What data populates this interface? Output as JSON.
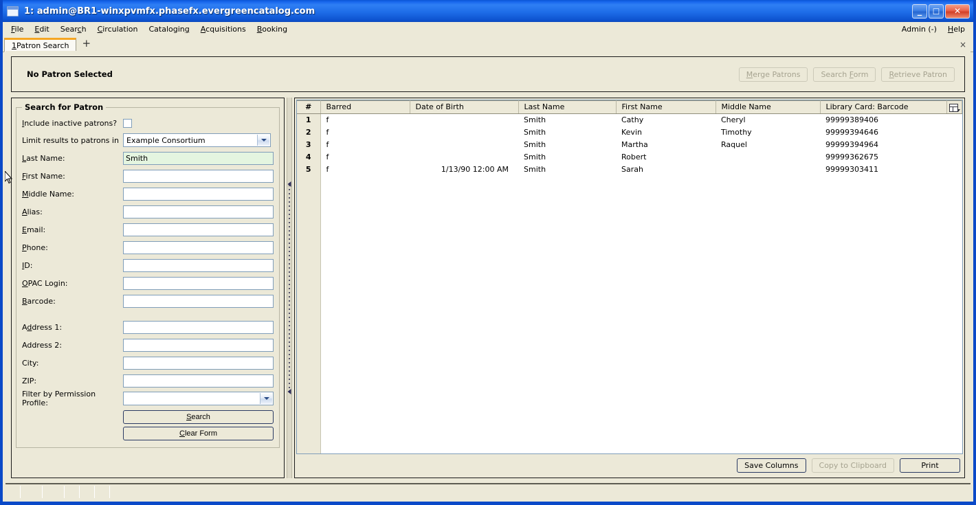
{
  "window": {
    "title": "1: admin@BR1-winxpvmfx.phasefx.evergreencatalog.com",
    "minimize_label": "_",
    "maximize_label": "□",
    "close_label": "✕",
    "icon": "window-icon"
  },
  "menubar": {
    "items": [
      {
        "acc": "F",
        "rest": "ile"
      },
      {
        "acc": "E",
        "rest": "dit"
      },
      {
        "pre": "Sear",
        "acc": "c",
        "rest": "h"
      },
      {
        "acc": "C",
        "rest": "irculation"
      },
      {
        "pre": "Catalogin",
        "acc": "g",
        "rest": ""
      },
      {
        "acc": "A",
        "rest": "cquisitions"
      },
      {
        "acc": "B",
        "rest": "ooking"
      }
    ],
    "right_items": [
      {
        "pre": "Admin (-)",
        "acc": "",
        "rest": ""
      },
      {
        "acc": "H",
        "rest": "elp"
      }
    ]
  },
  "tabs": {
    "active": {
      "num": "1",
      "label": " Patron Search"
    },
    "add_label": "+",
    "close_label": "×"
  },
  "patron_summary": {
    "title": "No Patron Selected",
    "buttons": [
      {
        "name": "merge-patrons-button",
        "acc": "M",
        "rest": "erge Patrons",
        "disabled": true
      },
      {
        "name": "search-form-button",
        "pre": "Search ",
        "acc": "F",
        "rest": "orm",
        "disabled": true
      },
      {
        "name": "retrieve-patron-button",
        "acc": "R",
        "rest": "etrieve Patron",
        "disabled": true
      }
    ]
  },
  "search_form": {
    "legend": "Search for Patron",
    "include_inactive": {
      "label_pre": "",
      "label_acc": "I",
      "label_rest": "nclude inactive patrons?",
      "checked": false
    },
    "limit_results": {
      "label": "Limit results to patrons in",
      "value": "Example Consortium"
    },
    "fields": [
      {
        "name": "last-name-field",
        "label_acc": "L",
        "label_rest": "ast Name:",
        "value": "Smith",
        "focused": true
      },
      {
        "name": "first-name-field",
        "label_acc": "F",
        "label_rest": "irst Name:",
        "value": "",
        "focused": false
      },
      {
        "name": "middle-name-field",
        "label_acc": "M",
        "label_rest": "iddle Name:",
        "value": "",
        "focused": false
      },
      {
        "name": "alias-field",
        "label_acc": "A",
        "label_rest": "lias:",
        "value": "",
        "focused": false
      },
      {
        "name": "email-field",
        "label_acc": "E",
        "label_rest": "mail:",
        "value": "",
        "focused": false
      },
      {
        "name": "phone-field",
        "label_acc": "P",
        "label_rest": "hone:",
        "value": "",
        "focused": false
      },
      {
        "name": "id-field",
        "label_acc": "I",
        "label_rest": "D:",
        "value": "",
        "focused": false
      },
      {
        "name": "opac-login-field",
        "label_acc": "O",
        "label_rest": "PAC Login:",
        "value": "",
        "focused": false
      },
      {
        "name": "barcode-field",
        "label_acc": "B",
        "label_rest": "arcode:",
        "value": "",
        "focused": false
      }
    ],
    "address_fields": [
      {
        "name": "address-1-field",
        "label_pre": "A",
        "label_acc": "d",
        "label_rest": "dress 1:",
        "value": ""
      },
      {
        "name": "address-2-field",
        "label_pre": "Address 2:",
        "label_acc": "",
        "label_rest": "",
        "value": ""
      },
      {
        "name": "city-field",
        "label_pre": "City:",
        "label_acc": "",
        "label_rest": "",
        "value": ""
      },
      {
        "name": "zip-field",
        "label_pre": "ZIP:",
        "label_acc": "",
        "label_rest": "",
        "value": ""
      }
    ],
    "permission_profile": {
      "label": "Filter by Permission Profile:",
      "value": ""
    },
    "search_button": {
      "acc": "S",
      "pre": "",
      "rest": "earch"
    },
    "clear_button": {
      "acc": "C",
      "pre": "",
      "rest": "lear Form"
    }
  },
  "results": {
    "columns": [
      "#",
      "Barred",
      "Date of Birth",
      "Last Name",
      "First Name",
      "Middle Name",
      "Library Card: Barcode"
    ],
    "column_picker_icon": "column-picker-icon",
    "rows": [
      {
        "num": "1",
        "barred": "f",
        "dob": "",
        "last": "Smith",
        "first": "Cathy",
        "middle": "Cheryl",
        "barcode": "99999389406"
      },
      {
        "num": "2",
        "barred": "f",
        "dob": "",
        "last": "Smith",
        "first": "Kevin",
        "middle": "Timothy",
        "barcode": "99999394646"
      },
      {
        "num": "3",
        "barred": "f",
        "dob": "",
        "last": "Smith",
        "first": "Martha",
        "middle": "Raquel",
        "barcode": "99999394964"
      },
      {
        "num": "4",
        "barred": "f",
        "dob": "",
        "last": "Smith",
        "first": "Robert",
        "middle": "",
        "barcode": "99999362675"
      },
      {
        "num": "5",
        "barred": "f",
        "dob": "1/13/90 12:00 AM",
        "last": "Smith",
        "first": "Sarah",
        "middle": "",
        "barcode": "99999303411"
      }
    ],
    "footer_buttons": [
      {
        "name": "save-columns-button",
        "label": "Save Columns",
        "disabled": false
      },
      {
        "name": "copy-to-clipboard-button",
        "label": "Copy to Clipboard",
        "disabled": true
      },
      {
        "name": "print-button",
        "label": "Print",
        "disabled": false
      }
    ]
  },
  "colors": {
    "titlebar_blue": "#1766ec",
    "window_border": "#0a49c8",
    "chrome_beige": "#ece9d8",
    "focused_field_green": "#e4f5e0",
    "tab_accent_orange": "#f5a623",
    "field_border_blue": "#7f9db9"
  }
}
